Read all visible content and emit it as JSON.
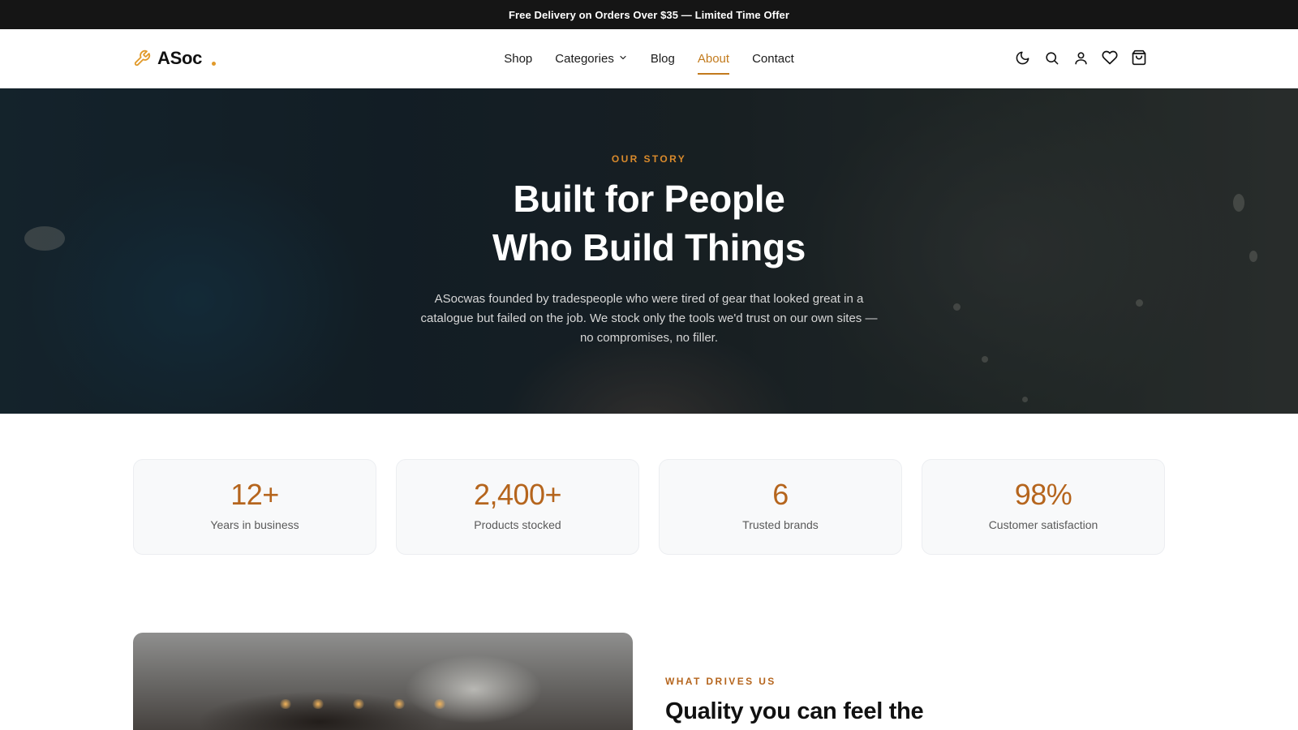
{
  "announcement": "Free Delivery on Orders Over $35 — Limited Time Offer",
  "brand": {
    "name": "ASoc",
    "accent": "#e19a2b"
  },
  "nav": {
    "links": [
      {
        "label": "Shop"
      },
      {
        "label": "Categories"
      },
      {
        "label": "Blog"
      },
      {
        "label": "About",
        "active": true
      },
      {
        "label": "Contact"
      }
    ],
    "icons": [
      "moon-icon",
      "search-icon",
      "user-icon",
      "heart-icon",
      "cart-icon"
    ]
  },
  "hero": {
    "eyebrow": "OUR STORY",
    "title_line1": "Built for People",
    "title_line2": "Who Build Things",
    "subtitle": "ASocwas founded by tradespeople who were tired of gear that looked great in a catalogue but failed on the job. We stock only the tools we'd trust on our own sites — no compromises, no filler."
  },
  "stats": [
    {
      "value": "12+",
      "label": "Years in business"
    },
    {
      "value": "2,400+",
      "label": "Products stocked"
    },
    {
      "value": "6",
      "label": "Trusted brands"
    },
    {
      "value": "98%",
      "label": "Customer satisfaction"
    }
  ],
  "drives": {
    "eyebrow": "WHAT DRIVES US",
    "title": "Quality you can feel the"
  },
  "colors": {
    "accent": "#c27a1c",
    "stat_value": "#b5651d",
    "topbar": "#151515"
  }
}
